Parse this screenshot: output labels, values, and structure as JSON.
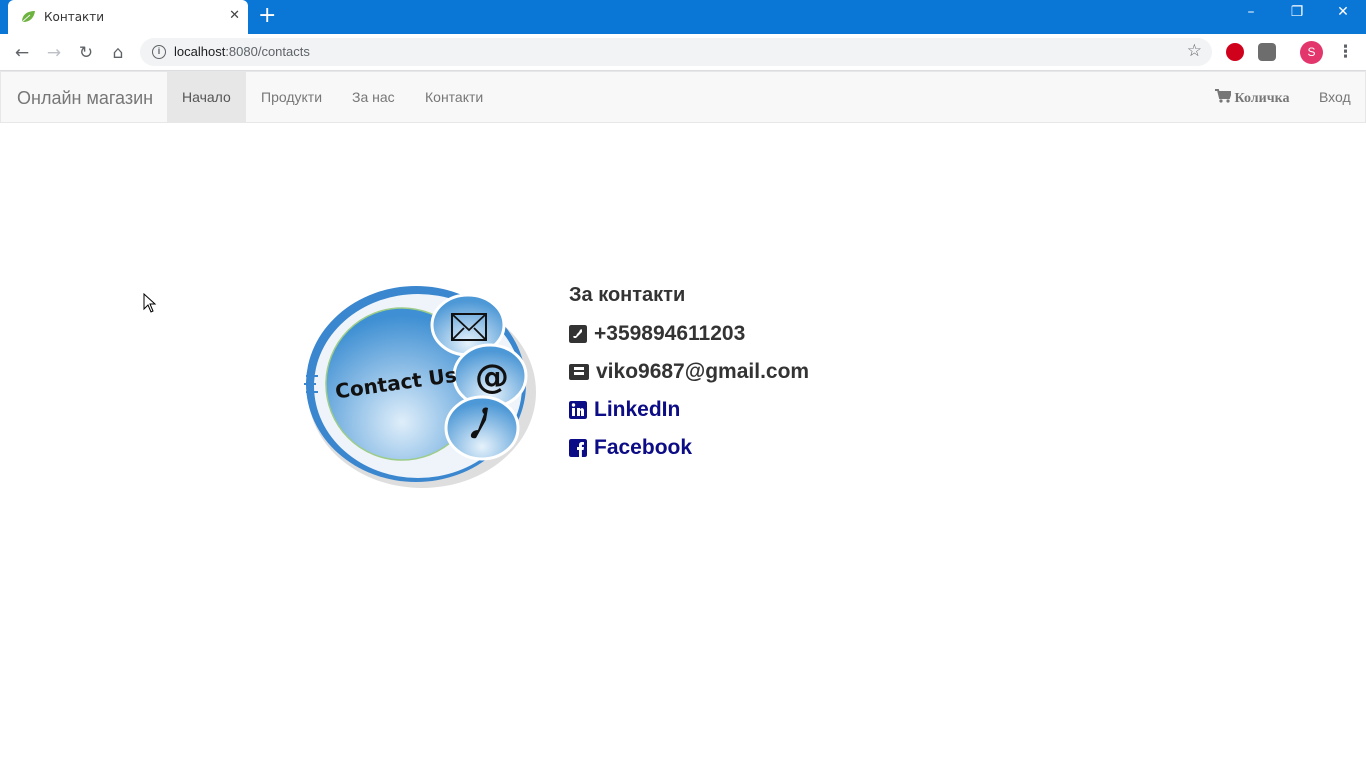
{
  "browser": {
    "tab_title": "Контакти",
    "url_host": "localhost",
    "url_path": ":8080/contacts",
    "profile_initial": "S"
  },
  "navbar": {
    "brand": "Онлайн магазин",
    "items": [
      {
        "label": "Начало"
      },
      {
        "label": "Продукти"
      },
      {
        "label": "За нас"
      },
      {
        "label": "Контакти"
      }
    ],
    "cart_label": "Количка",
    "login_label": "Вход"
  },
  "contacts": {
    "heading": "За контакти",
    "phone": "+359894611203",
    "email": "viko9687@gmail.com",
    "linkedin": "LinkedIn",
    "facebook": "Facebook"
  },
  "image": {
    "text": "Contact Us"
  },
  "colors": {
    "chrome_blue": "#0a76d6",
    "link_color": "#0c0c86",
    "avatar_color": "#e2366d"
  }
}
